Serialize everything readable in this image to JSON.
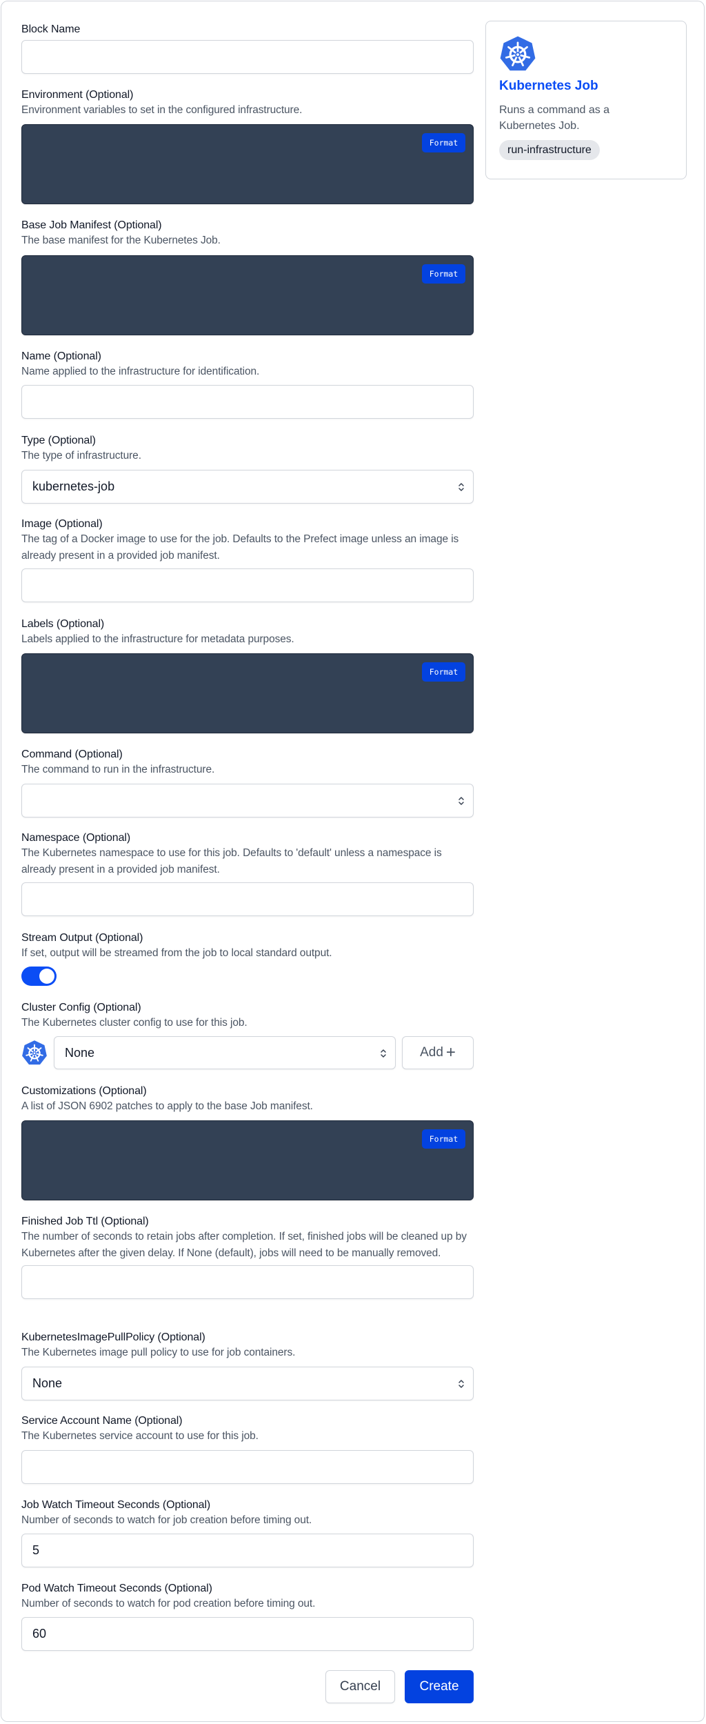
{
  "form": {
    "fields": {
      "block_name": {
        "label": "Block Name",
        "value": "",
        "placeholder": ""
      },
      "environment": {
        "label": "Environment (Optional)",
        "description": "Environment variables to set in the configured infrastructure.",
        "format_label": "Format"
      },
      "base_job_manifest": {
        "label": "Base Job Manifest (Optional)",
        "description": "The base manifest for the Kubernetes Job.",
        "format_label": "Format"
      },
      "name": {
        "label": "Name (Optional)",
        "description": "Name applied to the infrastructure for identification.",
        "value": ""
      },
      "type": {
        "label": "Type (Optional)",
        "description": "The type of infrastructure.",
        "selected": "kubernetes-job"
      },
      "image": {
        "label": "Image (Optional)",
        "description": "The tag of a Docker image to use for the job. Defaults to the Prefect image unless an image is already present in a provided job manifest.",
        "value": ""
      },
      "labels": {
        "label": "Labels (Optional)",
        "description": "Labels applied to the infrastructure for metadata purposes.",
        "format_label": "Format"
      },
      "command": {
        "label": "Command (Optional)",
        "description": "The command to run in the infrastructure.",
        "selected": ""
      },
      "namespace": {
        "label": "Namespace (Optional)",
        "description": "The Kubernetes namespace to use for this job. Defaults to 'default' unless a namespace is already present in a provided job manifest.",
        "value": ""
      },
      "stream_output": {
        "label": "Stream Output (Optional)",
        "description": "If set, output will be streamed from the job to local standard output.",
        "checked": true
      },
      "cluster_config": {
        "label": "Cluster Config (Optional)",
        "description": "The Kubernetes cluster config to use for this job.",
        "selected": "None",
        "add_label": "Add",
        "icon": "kubernetes-icon"
      },
      "customizations": {
        "label": "Customizations (Optional)",
        "description": "A list of JSON 6902 patches to apply to the base Job manifest.",
        "format_label": "Format"
      },
      "finished_job_ttl": {
        "label": "Finished Job Ttl (Optional)",
        "description": "The number of seconds to retain jobs after completion. If set, finished jobs will be cleaned up by Kubernetes after the given delay. If None (default), jobs will need to be manually removed.",
        "value": ""
      },
      "image_pull_policy": {
        "label": "KubernetesImagePullPolicy (Optional)",
        "description": "The Kubernetes image pull policy to use for job containers.",
        "selected": "None"
      },
      "service_account_name": {
        "label": "Service Account Name (Optional)",
        "description": "The Kubernetes service account to use for this job.",
        "value": ""
      },
      "job_watch_timeout": {
        "label": "Job Watch Timeout Seconds (Optional)",
        "description": "Number of seconds to watch for job creation before timing out.",
        "value": "5"
      },
      "pod_watch_timeout": {
        "label": "Pod Watch Timeout Seconds (Optional)",
        "description": "Number of seconds to watch for pod creation before timing out.",
        "value": "60"
      }
    },
    "actions": {
      "cancel_label": "Cancel",
      "create_label": "Create"
    }
  },
  "block_type_card": {
    "icon": "kubernetes-icon",
    "title": "Kubernetes Job",
    "description": "Runs a command as a Kubernetes Job.",
    "capability": "run-infrastructure"
  },
  "colors": {
    "primary": "#0342e0",
    "toggle_on": "#0b4df5",
    "editor_bg": "#334155",
    "kubernetes": "#326ce5"
  }
}
